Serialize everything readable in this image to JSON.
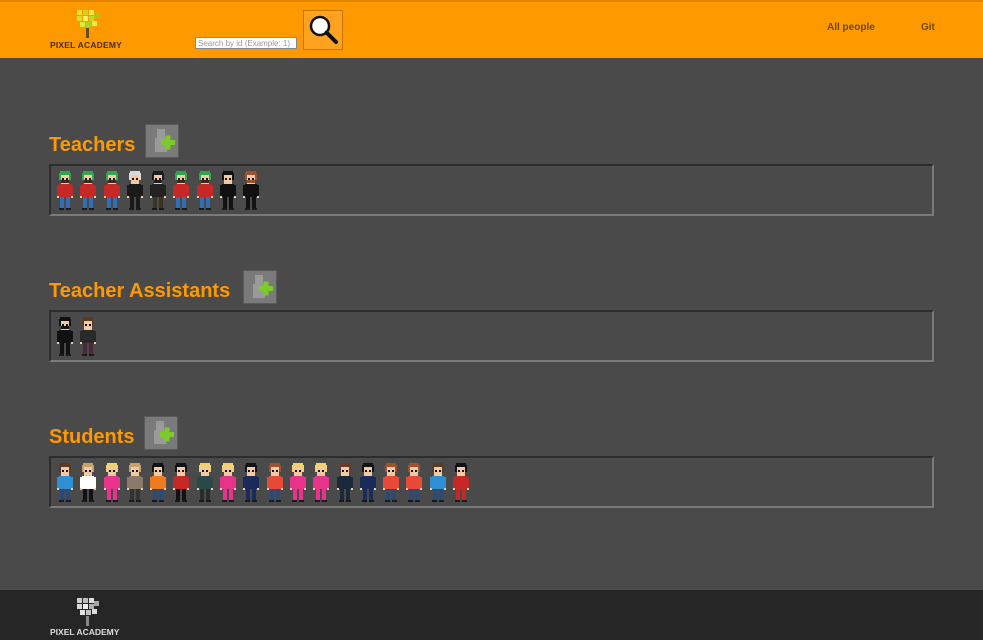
{
  "header": {
    "logo_text": "PIXEL ACADEMY",
    "search_placeholder": "Search by id (Example: 1)",
    "nav": [
      {
        "label": "All people"
      },
      {
        "label": "Git"
      }
    ]
  },
  "sections": [
    {
      "title": "Teachers",
      "people": [
        {
          "hair": "#2aa84a",
          "skin": "#f2c9a0",
          "shirt": "#c62828",
          "pants": "#2f6fb5",
          "beard": "#3a2a1a"
        },
        {
          "hair": "#2aa84a",
          "skin": "#f2c9a0",
          "shirt": "#c62828",
          "pants": "#2f6fb5",
          "beard": "#3a2a1a"
        },
        {
          "hair": "#2aa84a",
          "skin": "#f2c9a0",
          "shirt": "#c62828",
          "pants": "#2f6fb5",
          "beard": "#3a2a1a"
        },
        {
          "hair": "#d8d8d8",
          "skin": "#f2c9a0",
          "shirt": "#1a1a1a",
          "pants": "#1a1a1a",
          "beard": ""
        },
        {
          "hair": "#1a1a1a",
          "skin": "#f2c9a0",
          "shirt": "#222222",
          "pants": "#3a3322",
          "beard": "#1a1a1a"
        },
        {
          "hair": "#2aa84a",
          "skin": "#f2c9a0",
          "shirt": "#c62828",
          "pants": "#2f6fb5",
          "beard": "#3a2a1a"
        },
        {
          "hair": "#2aa84a",
          "skin": "#f2c9a0",
          "shirt": "#c62828",
          "pants": "#2f6fb5",
          "beard": "#3a2a1a"
        },
        {
          "hair": "#111111",
          "skin": "#f2c9a0",
          "shirt": "#111111",
          "pants": "#111111",
          "beard": ""
        },
        {
          "hair": "#a0522d",
          "skin": "#f2c9a0",
          "shirt": "#111111",
          "pants": "#111111",
          "beard": "#a0522d"
        }
      ]
    },
    {
      "title": "Teacher Assistants",
      "people": [
        {
          "hair": "#111111",
          "skin": "#f2c9a0",
          "shirt": "#111111",
          "pants": "#111111",
          "beard": "#111111"
        },
        {
          "hair": "#5a3a22",
          "skin": "#f2c9a0",
          "shirt": "#2a2a2a",
          "pants": "#4a2a3a",
          "beard": ""
        }
      ]
    },
    {
      "title": "Students",
      "people": [
        {
          "hair": "#5a3a22",
          "skin": "#f2c9a0",
          "shirt": "#2f8fd5",
          "pants": "#2a4a7a",
          "beard": ""
        },
        {
          "hair": "#c8a070",
          "skin": "#f2c9a0",
          "shirt": "#ffffff",
          "pants": "#111111",
          "beard": ""
        },
        {
          "hair": "#f0d070",
          "skin": "#f2c9a0",
          "shirt": "#e8338a",
          "pants": "#e8338a",
          "beard": ""
        },
        {
          "hair": "#c8a070",
          "skin": "#f2c9a0",
          "shirt": "#8a7a6a",
          "pants": "#333333",
          "beard": ""
        },
        {
          "hair": "#111111",
          "skin": "#f2c9a0",
          "shirt": "#f07a20",
          "pants": "#2a4a7a",
          "beard": ""
        },
        {
          "hair": "#111111",
          "skin": "#f2c9a0",
          "shirt": "#c62828",
          "pants": "#111111",
          "beard": ""
        },
        {
          "hair": "#f0d070",
          "skin": "#f2c9a0",
          "shirt": "#2a4a4a",
          "pants": "#2a2a2a",
          "beard": ""
        },
        {
          "hair": "#f0d070",
          "skin": "#f2c9a0",
          "shirt": "#e8338a",
          "pants": "#e8338a",
          "beard": ""
        },
        {
          "hair": "#111111",
          "skin": "#f2c9a0",
          "shirt": "#1a2a5a",
          "pants": "#1a2a5a",
          "beard": ""
        },
        {
          "hair": "#a0522d",
          "skin": "#f2c9a0",
          "shirt": "#e84a3a",
          "pants": "#2a4a7a",
          "beard": ""
        },
        {
          "hair": "#f0d070",
          "skin": "#f2c9a0",
          "shirt": "#e8338a",
          "pants": "#e8338a",
          "beard": ""
        },
        {
          "hair": "#f0d070",
          "skin": "#f2c9a0",
          "shirt": "#e8338a",
          "pants": "#e8338a",
          "beard": ""
        },
        {
          "hair": "#6a3a2a",
          "skin": "#f2c9a0",
          "shirt": "#1a2a3a",
          "pants": "#1a2a3a",
          "beard": ""
        },
        {
          "hair": "#111111",
          "skin": "#f2c9a0",
          "shirt": "#1a2a5a",
          "pants": "#1a2a5a",
          "beard": ""
        },
        {
          "hair": "#a0522d",
          "skin": "#f2c9a0",
          "shirt": "#e84a3a",
          "pants": "#2a4a7a",
          "beard": ""
        },
        {
          "hair": "#a0522d",
          "skin": "#f2c9a0",
          "shirt": "#e84a3a",
          "pants": "#2a4a7a",
          "beard": ""
        },
        {
          "hair": "#5a3a22",
          "skin": "#f2c9a0",
          "shirt": "#2f8fd5",
          "pants": "#2a4a7a",
          "beard": ""
        },
        {
          "hair": "#111111",
          "skin": "#f2c9a0",
          "shirt": "#c62828",
          "pants": "#c62828",
          "beard": ""
        }
      ]
    }
  ],
  "footer": {
    "logo_text": "PIXEL ACADEMY"
  },
  "colors": {
    "header_bg": "#ff9900",
    "page_bg": "#4a4a4a",
    "footer_bg": "#262626",
    "title": "#ff9900",
    "add_plus": "#7ccb2a"
  }
}
